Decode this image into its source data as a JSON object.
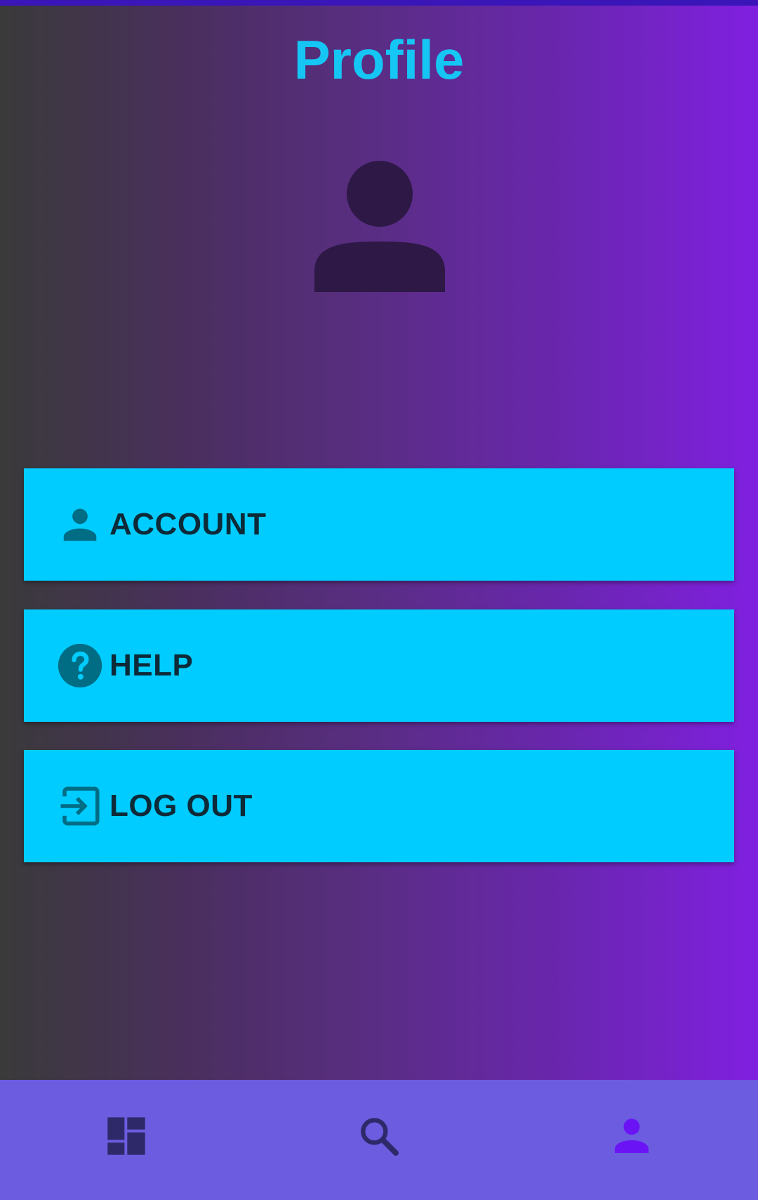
{
  "header": {
    "title": "Profile"
  },
  "avatar": {
    "icon": "person-icon",
    "color": "#2e1845"
  },
  "menu": {
    "items": [
      {
        "label": "ACCOUNT",
        "icon": "person-icon"
      },
      {
        "label": "HELP",
        "icon": "help-circle-icon"
      },
      {
        "label": "LOG OUT",
        "icon": "logout-icon"
      }
    ],
    "background": "#00ccff",
    "icon_color": "#006d85"
  },
  "bottom_nav": {
    "items": [
      {
        "icon": "dashboard-icon",
        "active": false
      },
      {
        "icon": "search-icon",
        "active": false
      },
      {
        "icon": "person-icon",
        "active": true
      }
    ],
    "background": "#6c5ce0",
    "active_color": "#6a14f5",
    "inactive_color": "#2e2a6a"
  },
  "colors": {
    "title": "#15c6f5",
    "status_bar": "#3a16b8"
  }
}
